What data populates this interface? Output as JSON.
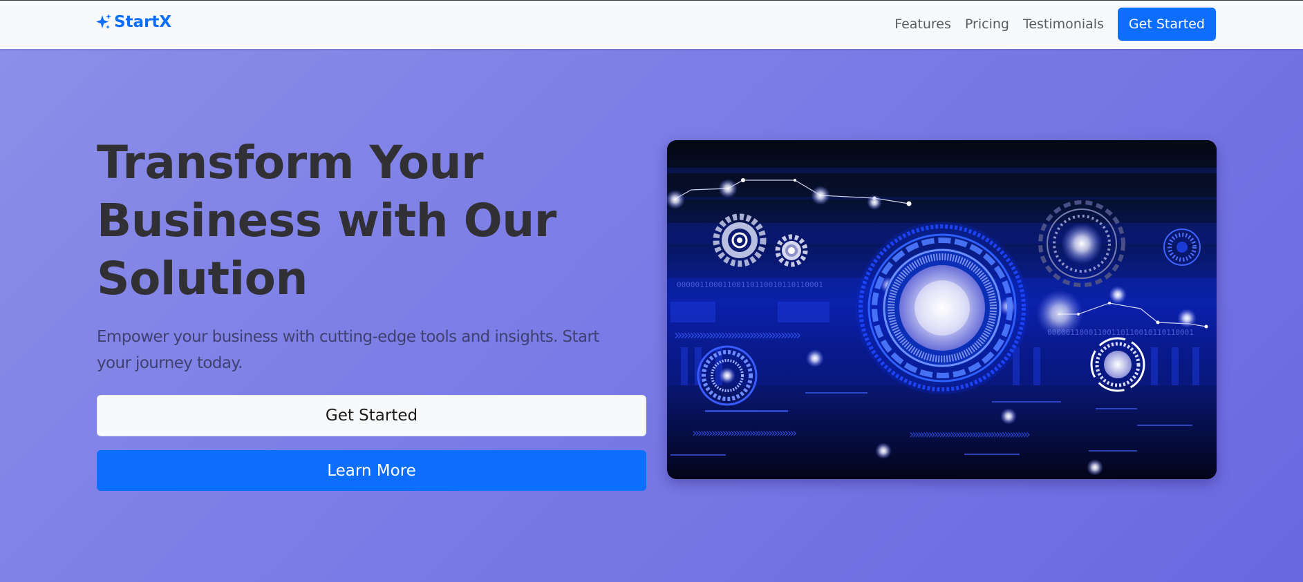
{
  "navbar": {
    "brand": "StartX",
    "brand_icon": "sparkles-icon",
    "links": [
      "Features",
      "Pricing",
      "Testimonials"
    ],
    "cta_label": "Get Started"
  },
  "hero": {
    "title": "Transform Your Business with Our Solution",
    "subtitle": "Empower your business with cutting-edge tools and insights. Start your journey today.",
    "primary_button": "Get Started",
    "secondary_button": "Learn More",
    "image": {
      "binary_text_top": "00000110001100110110010110110001",
      "binary_text_right": "00000110001100110110010110110001"
    }
  },
  "colors": {
    "brand": "#0d6efd",
    "navbar_bg": "#f8f9fa",
    "hero_gradient_start": "#8c8ee8",
    "hero_gradient_end": "#6b68e0",
    "title_text": "#303035",
    "image_bg": "#050a1c"
  }
}
